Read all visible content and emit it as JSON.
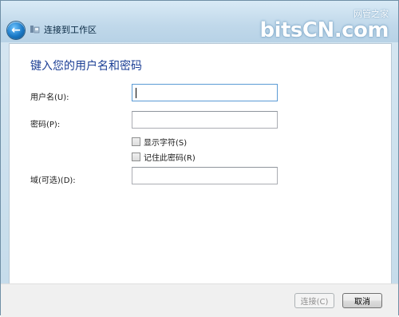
{
  "window": {
    "title": "连接到工作区"
  },
  "watermark": {
    "top": "网管之家",
    "main": "bitsCN.com"
  },
  "form": {
    "heading": "键入您的用户名和密码",
    "username_label": "用户名(U):",
    "username_value": "",
    "password_label": "密码(P):",
    "password_value": "",
    "show_chars_label": "显示字符(S)",
    "show_chars_checked": false,
    "remember_label": "记住此密码(R)",
    "remember_checked": false,
    "domain_label": "域(可选)(D):",
    "domain_value": ""
  },
  "footer": {
    "connect_label": "连接(C)",
    "cancel_label": "取消"
  },
  "colors": {
    "heading": "#1c3f95",
    "titlebar": "#c4dbea",
    "back_button": "#1b79c6"
  },
  "icons": {
    "back": "back-arrow-icon",
    "app": "network-app-icon"
  }
}
